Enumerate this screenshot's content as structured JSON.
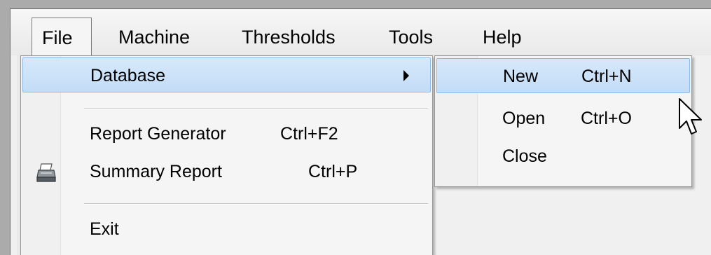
{
  "menubar": {
    "items": [
      {
        "label": "File"
      },
      {
        "label": "Machine"
      },
      {
        "label": "Thresholds"
      },
      {
        "label": "Tools"
      },
      {
        "label": "Help"
      }
    ]
  },
  "file_menu": {
    "database_label": "Database",
    "report_generator_label": "Report Generator",
    "report_generator_shortcut": "Ctrl+F2",
    "summary_report_label": "Summary Report",
    "summary_report_shortcut": "Ctrl+P",
    "exit_label": "Exit",
    "icons": {
      "summary_report": "printer-icon",
      "submenu": "submenu-arrow-icon"
    }
  },
  "database_submenu": {
    "new_label": "New",
    "new_shortcut": "Ctrl+N",
    "open_label": "Open",
    "open_shortcut": "Ctrl+O",
    "close_label": "Close"
  },
  "colors": {
    "highlight": "#c3dcf6",
    "highlight_border": "#8eb8e6"
  }
}
